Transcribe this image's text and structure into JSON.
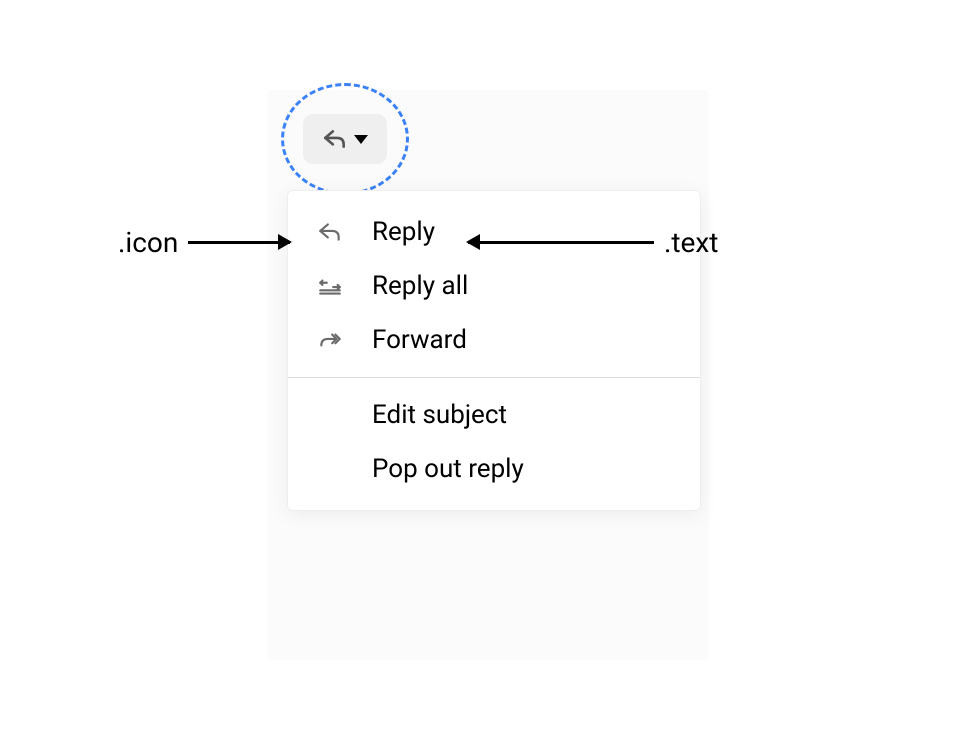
{
  "button": {
    "icon_name": "reply-icon"
  },
  "menu": {
    "items": [
      {
        "icon": "reply-icon",
        "label": "Reply"
      },
      {
        "icon": "reply-all-icon",
        "label": "Reply all"
      },
      {
        "icon": "forward-icon",
        "label": "Forward"
      }
    ],
    "secondary_items": [
      {
        "label": "Edit subject"
      },
      {
        "label": "Pop out reply"
      }
    ]
  },
  "annotations": {
    "icon_label": ".icon",
    "text_label": ".text"
  }
}
